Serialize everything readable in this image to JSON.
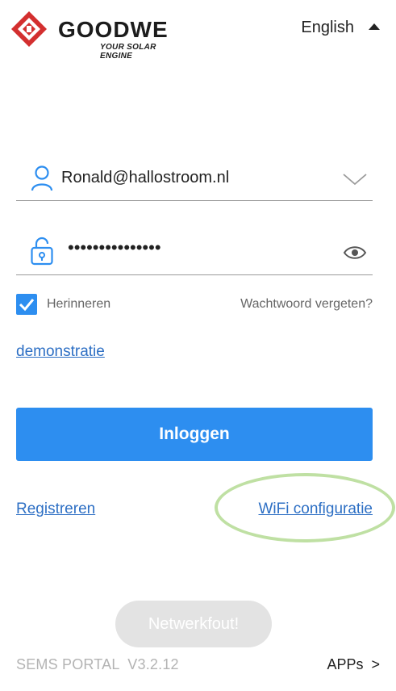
{
  "header": {
    "brand_name": "GOODWE",
    "brand_tagline": "YOUR SOLAR ENGINE",
    "language": "English",
    "logo_icon": "goodwe-diamond-logo"
  },
  "login_form": {
    "username_value": "Ronald@hallostroom.nl",
    "password_masked": "•••••••••••••••",
    "remember_label": "Herinneren",
    "remember_checked": true,
    "forgot_password_label": "Wachtwoord vergeten?",
    "demo_link": "demonstratie",
    "login_button": "Inloggen",
    "register_link": "Registreren",
    "wifi_config_link": "WiFi configuratie"
  },
  "status": {
    "network_error": "Netwerkfout!"
  },
  "footer": {
    "version_label": "SEMS PORTAL  V3.2.12",
    "apps_link": "APPs  >"
  },
  "colors": {
    "accent": "#2d8ef0",
    "link": "#2d6fc4",
    "highlight_circle": "#bfe0a3",
    "brand_red": "#d32f2f"
  }
}
